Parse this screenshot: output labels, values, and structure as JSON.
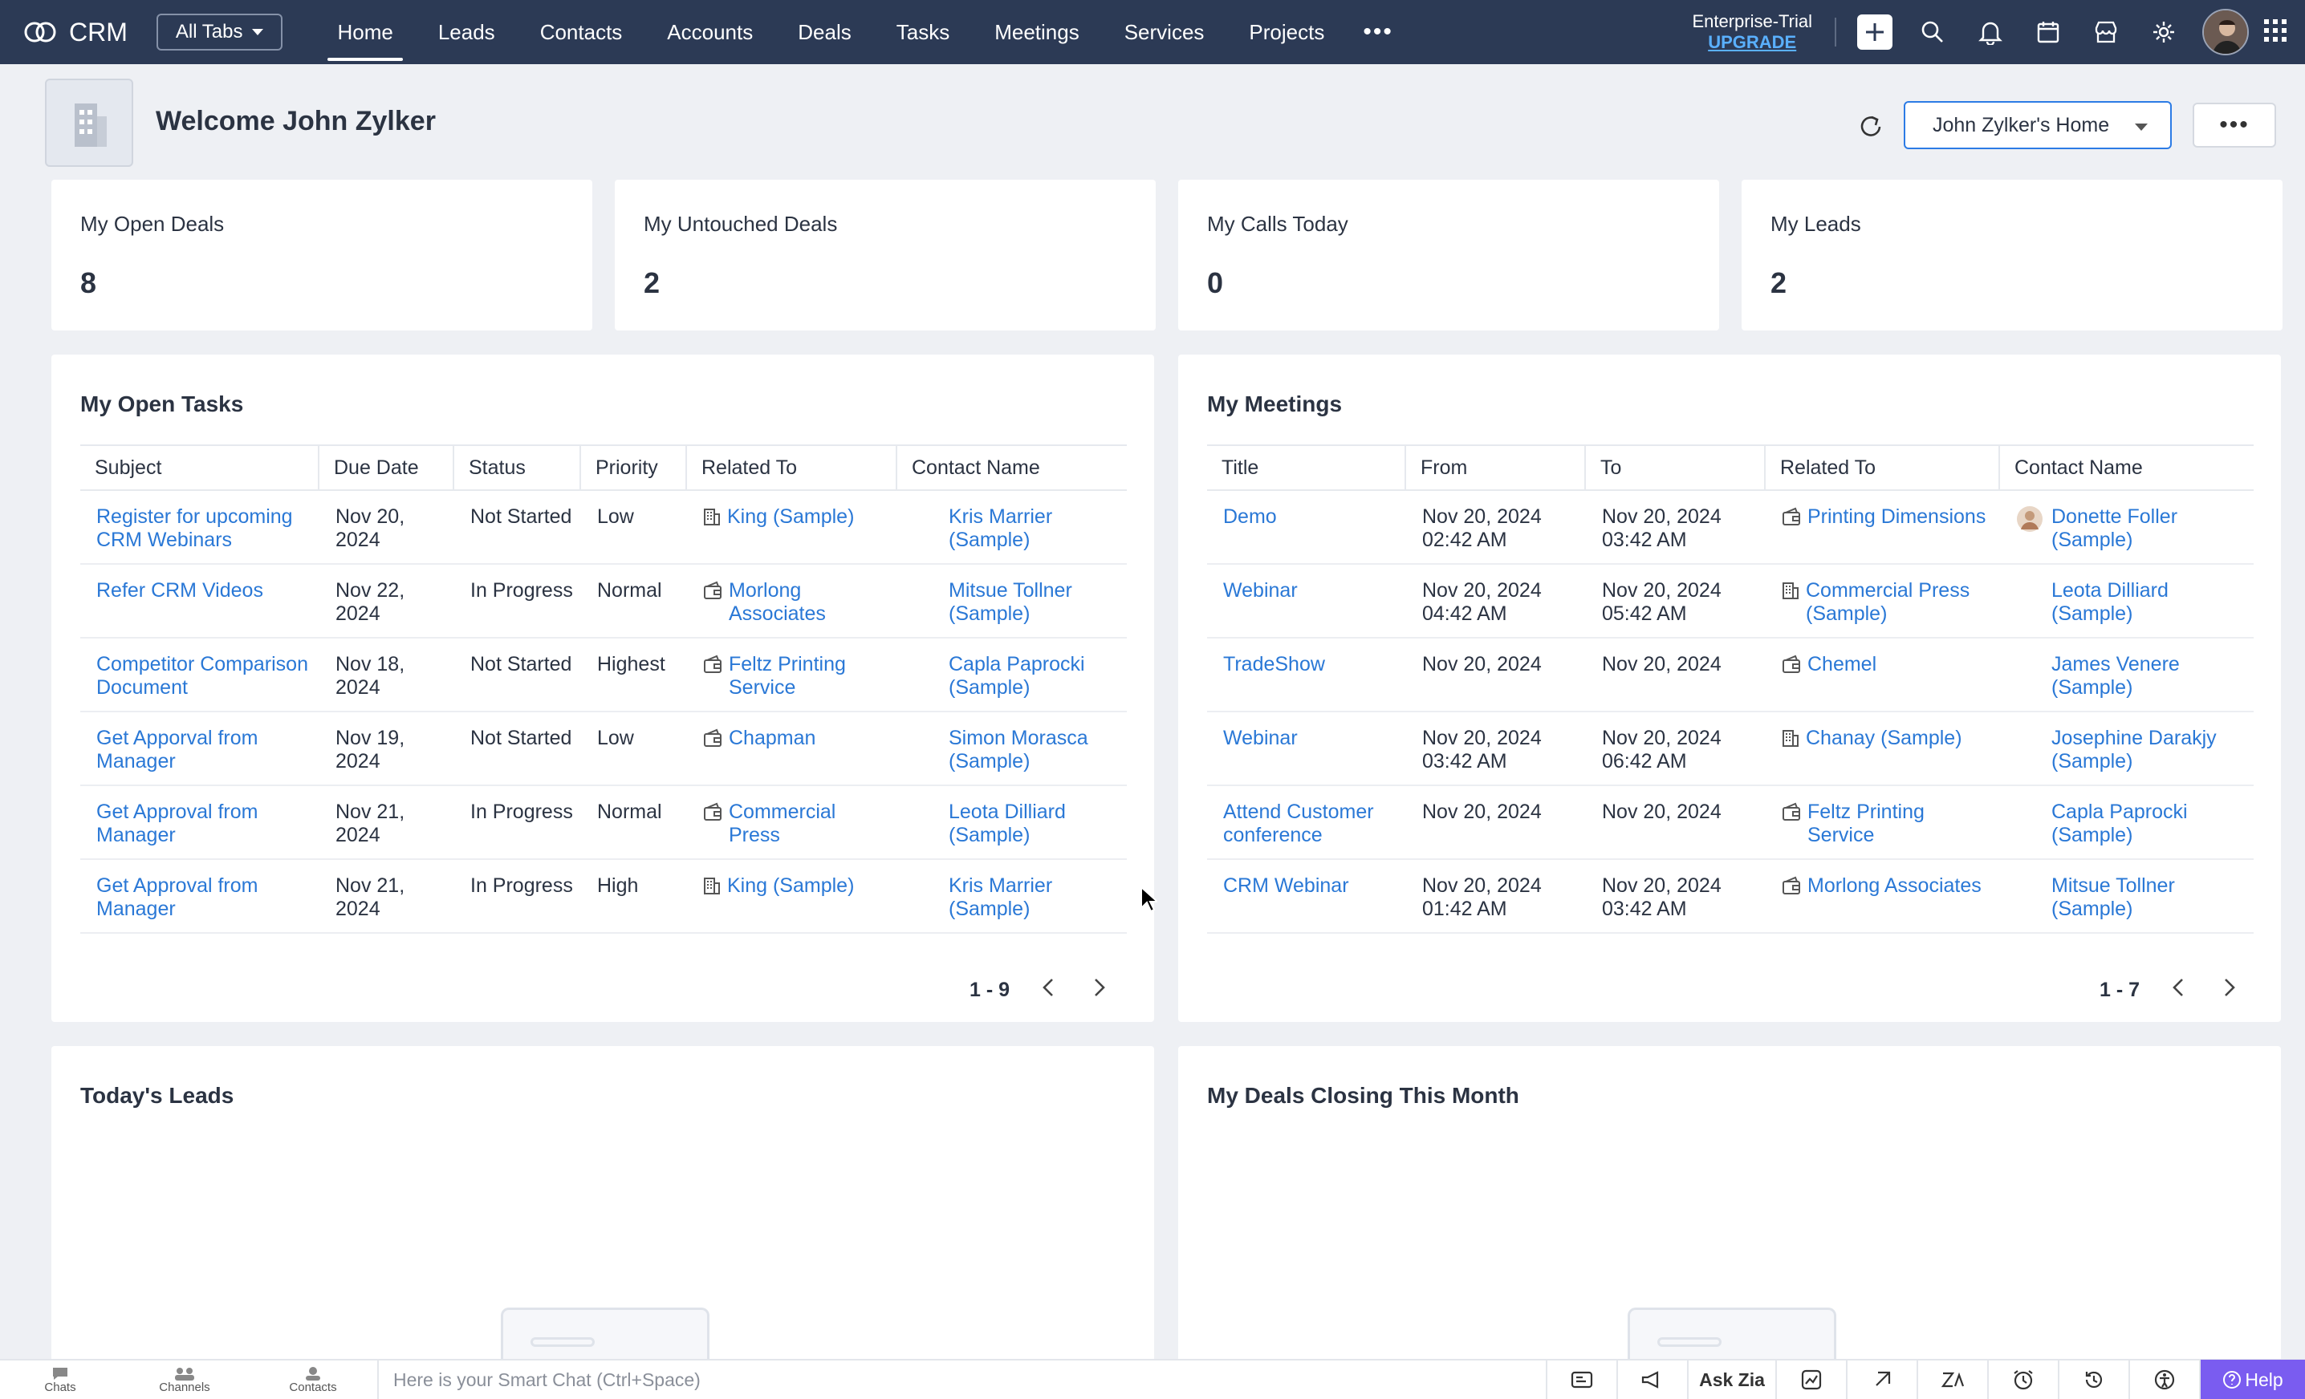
{
  "nav": {
    "brand": "CRM",
    "all_tabs": "All Tabs",
    "tabs": [
      "Home",
      "Leads",
      "Contacts",
      "Accounts",
      "Deals",
      "Tasks",
      "Meetings",
      "Services",
      "Projects"
    ],
    "active_tab": "Home",
    "trial_label": "Enterprise-Trial",
    "upgrade_label": "UPGRADE"
  },
  "header": {
    "welcome": "Welcome John Zylker",
    "home_select": "John Zylker's Home"
  },
  "kpis": [
    {
      "label": "My Open Deals",
      "value": "8"
    },
    {
      "label": "My Untouched Deals",
      "value": "2"
    },
    {
      "label": "My Calls Today",
      "value": "0"
    },
    {
      "label": "My Leads",
      "value": "2"
    }
  ],
  "tasks": {
    "title": "My Open Tasks",
    "columns": [
      "Subject",
      "Due Date",
      "Status",
      "Priority",
      "Related To",
      "Contact Name"
    ],
    "rows": [
      {
        "subject": "Register for upcoming CRM Webinars",
        "due": "Nov 20, 2024",
        "status": "Not Started",
        "priority": "Low",
        "related": "King (Sample)",
        "related_icon": "building-icon",
        "contact": "Kris Marrier (Sample)"
      },
      {
        "subject": "Refer CRM Videos",
        "due": "Nov 22, 2024",
        "status": "In Progress",
        "priority": "Normal",
        "related": "Morlong Associates",
        "related_icon": "deal-icon",
        "contact": "Mitsue Tollner (Sample)"
      },
      {
        "subject": "Competitor Comparison Document",
        "due": "Nov 18, 2024",
        "status": "Not Started",
        "priority": "Highest",
        "related": "Feltz Printing Service",
        "related_icon": "deal-icon",
        "contact": "Capla Paprocki (Sample)"
      },
      {
        "subject": "Get Apporval from Manager",
        "due": "Nov 19, 2024",
        "status": "Not Started",
        "priority": "Low",
        "related": "Chapman",
        "related_icon": "deal-icon",
        "contact": "Simon Morasca (Sample)"
      },
      {
        "subject": "Get Approval from Manager",
        "due": "Nov 21, 2024",
        "status": "In Progress",
        "priority": "Normal",
        "related": "Commercial Press",
        "related_icon": "deal-icon",
        "contact": "Leota Dilliard (Sample)"
      },
      {
        "subject": "Get Approval from Manager",
        "due": "Nov 21, 2024",
        "status": "In Progress",
        "priority": "High",
        "related": "King (Sample)",
        "related_icon": "building-icon",
        "contact": "Kris Marrier (Sample)"
      }
    ],
    "pager": "1 - 9"
  },
  "meetings": {
    "title": "My Meetings",
    "columns": [
      "Title",
      "From",
      "To",
      "Related To",
      "Contact Name"
    ],
    "rows": [
      {
        "title": "Demo",
        "from": "Nov 20, 2024 02:42 AM",
        "to": "Nov 20, 2024 03:42 AM",
        "related": "Printing Dimensions",
        "related_icon": "deal-icon",
        "contact": "Donette Foller (Sample)"
      },
      {
        "title": "Webinar",
        "from": "Nov 20, 2024 04:42 AM",
        "to": "Nov 20, 2024 05:42 AM",
        "related": "Commercial Press (Sample)",
        "related_icon": "building-icon",
        "contact": "Leota Dilliard (Sample)"
      },
      {
        "title": "TradeShow",
        "from": "Nov 20, 2024",
        "to": "Nov 20, 2024",
        "related": "Chemel",
        "related_icon": "deal-icon",
        "contact": "James Venere (Sample)"
      },
      {
        "title": "Webinar",
        "from": "Nov 20, 2024 03:42 AM",
        "to": "Nov 20, 2024 06:42 AM",
        "related": "Chanay (Sample)",
        "related_icon": "building-icon",
        "contact": "Josephine Darakjy (Sample)"
      },
      {
        "title": "Attend Customer conference",
        "from": "Nov 20, 2024",
        "to": "Nov 20, 2024",
        "related": "Feltz Printing Service",
        "related_icon": "deal-icon",
        "contact": "Capla Paprocki (Sample)"
      },
      {
        "title": "CRM Webinar",
        "from": "Nov 20, 2024 01:42 AM",
        "to": "Nov 20, 2024 03:42 AM",
        "related": "Morlong Associates",
        "related_icon": "deal-icon",
        "contact": "Mitsue Tollner (Sample)"
      }
    ],
    "pager": "1 - 7"
  },
  "leads_panel": {
    "title": "Today's Leads"
  },
  "deals_panel": {
    "title": "My Deals Closing This Month"
  },
  "bottombar": {
    "items": [
      "Chats",
      "Channels",
      "Contacts"
    ],
    "smart_chat_placeholder": "Here is your Smart Chat (Ctrl+Space)",
    "ask_zia": "Ask Zia",
    "help": "Help"
  },
  "colors": {
    "nav_bg": "#2c3a55",
    "link": "#2a78d6",
    "accent": "#2c7be5",
    "help": "#7a5cf0"
  }
}
